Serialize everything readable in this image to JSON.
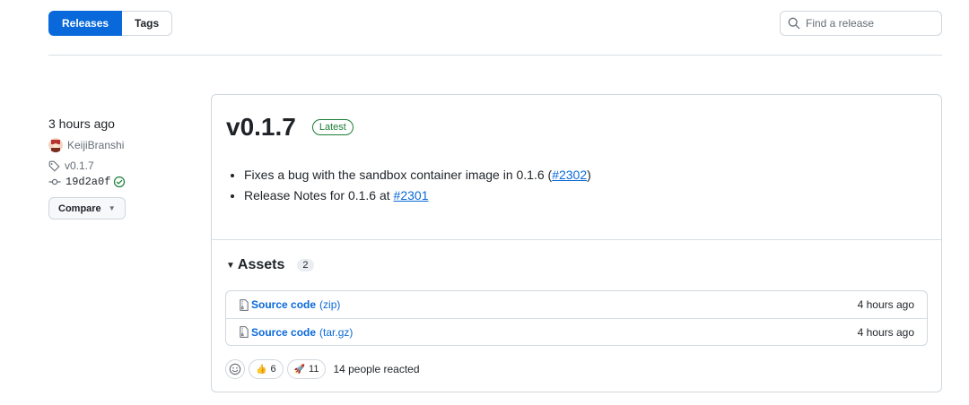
{
  "subnav": {
    "releases": "Releases",
    "tags": "Tags"
  },
  "search": {
    "placeholder": "Find a release"
  },
  "meta": {
    "time": "3 hours ago",
    "author": "KeijiBranshi",
    "tag": "v0.1.7",
    "commit": "19d2a0f",
    "compare": "Compare"
  },
  "release": {
    "title": "v0.1.7",
    "badge": "Latest",
    "notes": [
      {
        "text": "Fixes a bug with the sandbox container image in 0.1.6 (",
        "link": "#2302",
        "after": ")"
      },
      {
        "text": "Release Notes for 0.1.6 at ",
        "link": "#2301",
        "after": ""
      }
    ]
  },
  "assets": {
    "title": "Assets",
    "count": "2",
    "items": [
      {
        "name": "Source code",
        "ext": "(zip)",
        "when": "4 hours ago"
      },
      {
        "name": "Source code",
        "ext": "(tar.gz)",
        "when": "4 hours ago"
      }
    ]
  },
  "reactions": {
    "items": [
      {
        "emoji": "👍",
        "count": "6"
      },
      {
        "emoji": "🚀",
        "count": "11"
      }
    ],
    "summary": "14 people reacted"
  },
  "icons": [
    "search-icon",
    "tag-icon",
    "commit-icon",
    "check-circle-icon",
    "file-zip-icon",
    "smiley-icon"
  ],
  "colors": {
    "accent": "#0969da",
    "success": "#1a7f37"
  }
}
